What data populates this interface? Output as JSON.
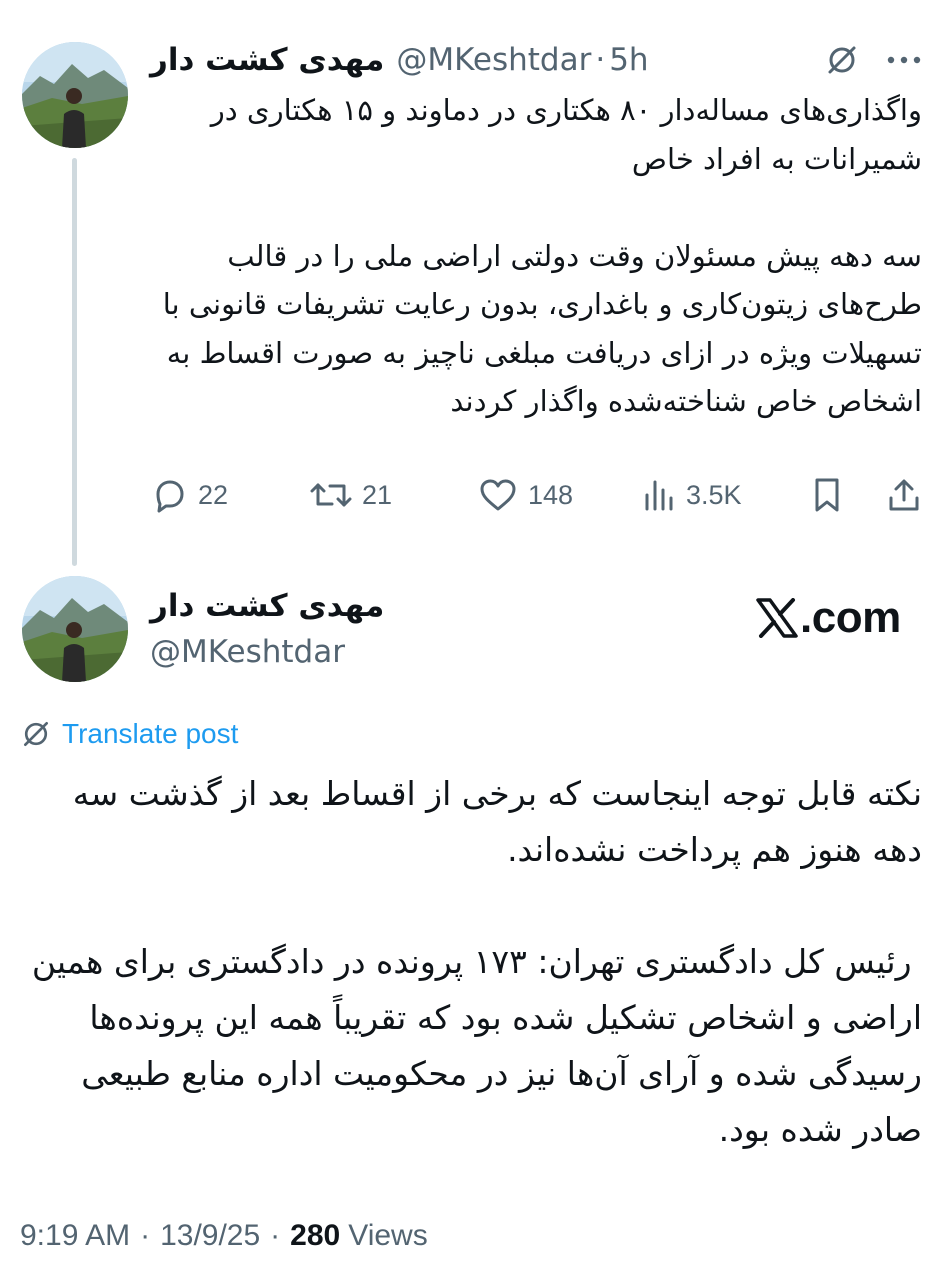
{
  "tweet1": {
    "author_name": "مهدی کشت دار",
    "handle": "@MKeshtdar",
    "separator": "·",
    "time": "5h",
    "text": "واگذاری‌های مساله‌دار ۸۰ هکتاری در دماوند و ۱۵ هکتاری در شمیرانات به افراد خاص\n\nسه دهه پیش مسئولان وقت دولتی اراضی ملی را در قالب طرح‌های زیتون‌کاری و باغداری، بدون رعایت تشریفات قانونی با تسهیلات ویژه در ازای دریافت مبلغی ناچیز به صورت اقساط به اشخاص خاص شناخته‌شده واگذار کردند",
    "stats": {
      "replies": "22",
      "reposts": "21",
      "likes": "148",
      "views": "3.5K"
    },
    "icons": [
      "grok-icon",
      "more-icon",
      "reply-icon",
      "repost-icon",
      "like-icon",
      "views-icon",
      "bookmark-icon",
      "share-icon"
    ]
  },
  "tweet2": {
    "author_name": "مهدی کشت دار",
    "handle": "@MKeshtdar",
    "source_logo_text": ".com",
    "translate_label": "Translate post",
    "text": "نکته قابل توجه اینجاست که برخی از اقساط بعد از گذشت سه دهه هنوز هم پرداخت نشده‌اند.\n\n رئیس کل دادگستری تهران: ۱۷۳ پرونده در دادگستری برای همین اراضی و اشخاص تشکیل شده بود که تقریباً همه این پرونده‌ها رسیدگی شده و آرای آن‌ها نیز در محکومیت اداره منابع طبیعی صادر شده بود.",
    "time": "9:19 AM",
    "date": "13/9/25",
    "separator": "·",
    "views_count": "280",
    "views_label": "Views"
  },
  "colors": {
    "text": "#0f1419",
    "secondary": "#536471",
    "link": "#1d9bf0",
    "thread_line": "#cfd9de"
  }
}
